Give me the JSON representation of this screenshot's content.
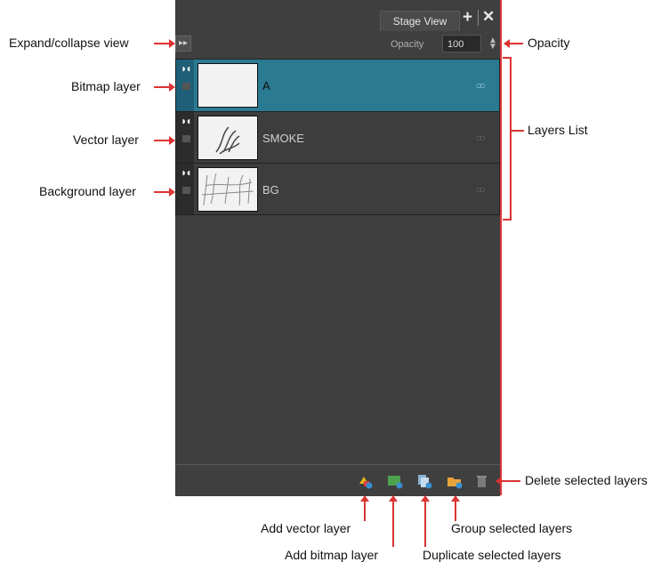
{
  "panel": {
    "tab_label": "Stage View",
    "tab_add_icon": "plus-icon",
    "tab_close_icon": "close-icon",
    "opacity_label": "Opacity",
    "opacity_value": "100",
    "accent_color": "#2a7a92",
    "layers": [
      {
        "name": "A",
        "selected": true,
        "thumbnail": "blank"
      },
      {
        "name": "SMOKE",
        "selected": false,
        "thumbnail": "smoke-sketch"
      },
      {
        "name": "BG",
        "selected": false,
        "thumbnail": "background-sketch"
      }
    ],
    "toolbar_icons": [
      "add-vector-layer-icon",
      "add-bitmap-layer-icon",
      "duplicate-layers-icon",
      "group-layers-icon",
      "delete-layers-icon"
    ]
  },
  "callouts": {
    "expand": "Expand/collapse view",
    "bitmap": "Bitmap layer",
    "vector": "Vector layer",
    "background": "Background layer",
    "opacity": "Opacity",
    "layers_list": "Layers List",
    "delete": "Delete selected layers",
    "add_vector": "Add vector layer",
    "add_bitmap": "Add bitmap layer",
    "group": "Group selected layers",
    "duplicate": "Duplicate selected layers"
  }
}
